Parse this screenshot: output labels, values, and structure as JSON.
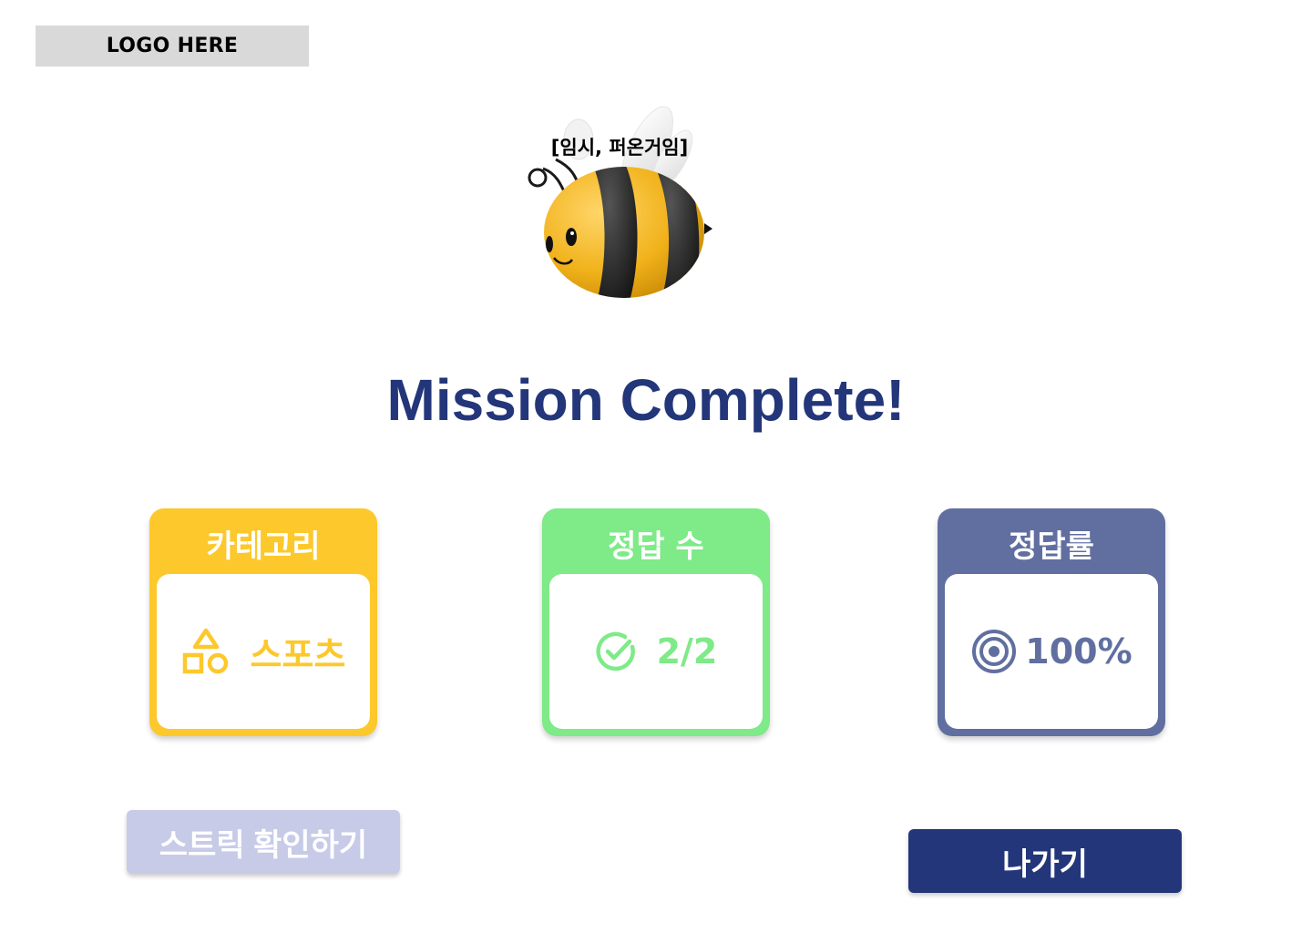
{
  "logo": {
    "text": "LOGO HERE"
  },
  "mascot": {
    "caption": "[임시, 퍼온거임]",
    "icon": "bee-mascot"
  },
  "title": "Mission Complete!",
  "cards": {
    "category": {
      "label": "카테고리",
      "value": "스포츠",
      "icon": "shapes-icon",
      "color": "#fdc82b"
    },
    "correct": {
      "label": "정답 수",
      "value": "2/2",
      "icon": "check-circle-icon",
      "color": "#7eea88"
    },
    "rate": {
      "label": "정답률",
      "value": "100%",
      "icon": "target-icon",
      "color": "#616fa0"
    }
  },
  "buttons": {
    "streak": "스트릭 확인하기",
    "exit": "나가기"
  },
  "colors": {
    "title": "#23367a",
    "streak_button": "#c7cbe8",
    "exit_button": "#23367a"
  }
}
